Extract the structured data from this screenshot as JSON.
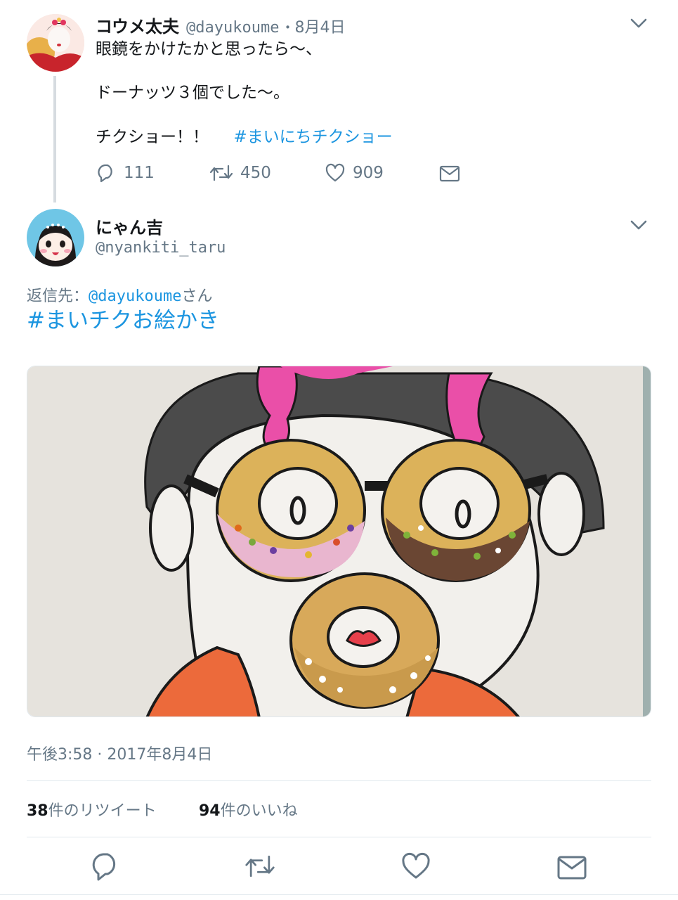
{
  "original_tweet": {
    "display_name": "コウメ太夫",
    "handle": "@dayukoume",
    "separator": "・",
    "date": "8月4日",
    "lines": [
      "眼鏡をかけたかと思ったら〜、",
      "ドーナッツ３個でした〜。",
      "チクショー！！"
    ],
    "hashtag": "#まいにちチクショー",
    "reply_count": "111",
    "retweet_count": "450",
    "like_count": "909"
  },
  "reply_tweet": {
    "display_name": "にゃん吉",
    "handle": "@nyankiti_taru",
    "reply_prefix": "返信先：",
    "reply_to": "@dayukoume",
    "reply_suffix": "さん",
    "hashtag": "#まいチクお絵かき",
    "timestamp": "午後3:58 · 2017年8月4日",
    "retweets_num": "38",
    "retweets_label": "件のリツイート",
    "likes_num": "94",
    "likes_label": "件のいいね"
  },
  "colors": {
    "link": "#1b95e0",
    "secondary_text": "#657786",
    "divider": "#e1e8ed"
  },
  "icons": [
    "chevron-down-icon",
    "reply-icon",
    "retweet-icon",
    "like-icon",
    "message-icon"
  ]
}
